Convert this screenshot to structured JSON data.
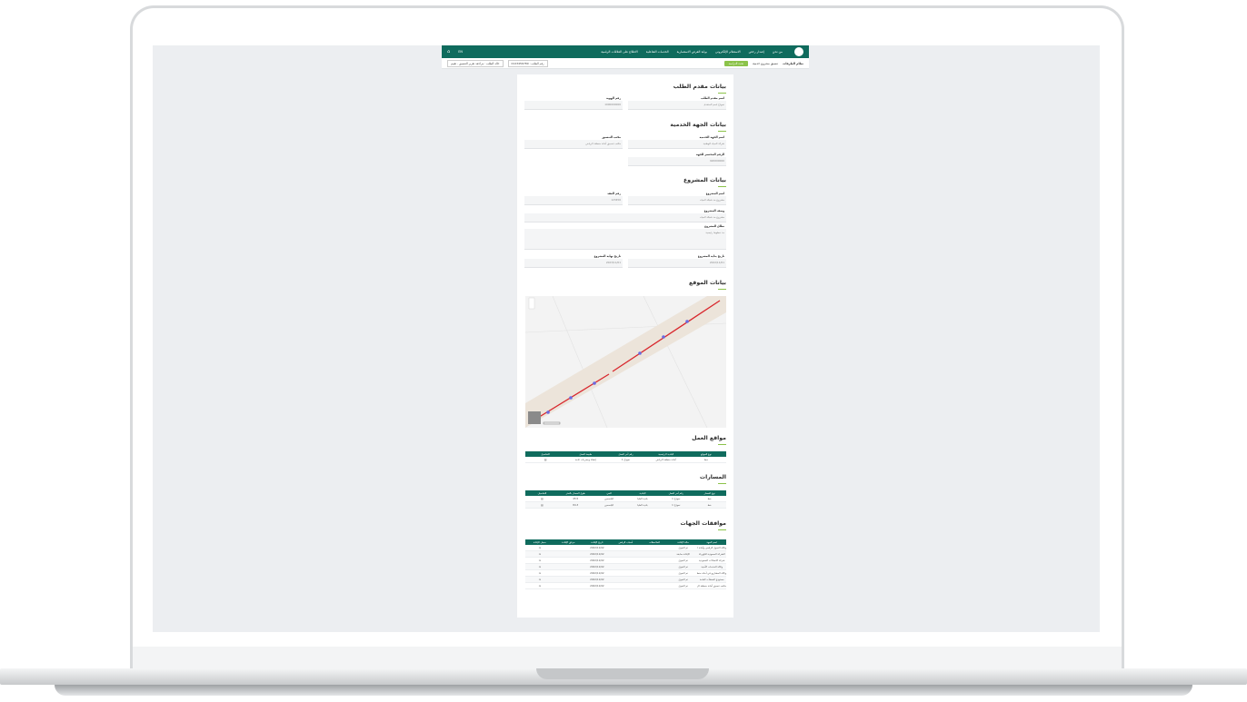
{
  "topbar": {
    "nav": [
      "من نحن",
      "إصدار رخص",
      "الاستعلام الإلكتروني",
      "بوابة الفرص الاستثمارية",
      "الخدمات التفاعلية",
      "الاطلاع على العلاقات الرقمية"
    ],
    "lang": "EN"
  },
  "subbar": {
    "system": "نظام الطرقات",
    "service": "تنسيق مشروع خدمية",
    "status": "تحت الدراسة",
    "request_type": "حالة الطلب : مراجعة تقرير التنسيق - تقييم",
    "request_no": "رقم الطلب : 0123456789"
  },
  "sections": {
    "applicant": "بيانات مقدم الطلب",
    "entity": "بيانات الجهة الخدمية",
    "project": "بيانات المشروع",
    "location": "بيانات الموقع",
    "work_sites": "مواقع العمل",
    "paths": "المسارات",
    "approvals": "موافقات الجهات"
  },
  "applicant": {
    "name_label": "اسم مقدم الطلب",
    "name_value": "نموذج اسم المتقدم",
    "id_label": "رقم الهوية",
    "id_value": "1000000000"
  },
  "entity": {
    "name_label": "اسم الجهة الخدمية",
    "name_value": "شركة المياه الوطنية",
    "office_label": "مكتب التنسيق",
    "office_value": "مكتب تنسيق أمانة منطقة الرياض",
    "phone_label": "الرقم المختصر للجهة",
    "phone_value": "920000000"
  },
  "project": {
    "name_label": "اسم المشروع",
    "name_value": "مشروع مد شبكة المياه",
    "contract_label": "رقم العقد",
    "contract_value": "123456",
    "desc_label": "وصف المشروع",
    "desc_value": "مشروع مد شبكة المياه",
    "scope_label": "نطاق المشروع",
    "scope_value": "مد خطوط رئيسية",
    "start_label": "تاريخ بداية المشروع",
    "start_value": "2022/11/01",
    "end_label": "تاريخ نهاية المشروع",
    "end_value": "2023/11/01"
  },
  "work_sites": {
    "headers": [
      "نوع الموقع",
      "البلدية الرئيسية",
      "رقم أمر العمل",
      "طبيعة العمل",
      "التفاصيل"
    ],
    "rows": [
      [
        "خط",
        "أمانة منطقة الرياض",
        "نموذج 1",
        "إنشاء وحفريات عامة",
        "▤"
      ]
    ]
  },
  "paths": {
    "headers": [
      "نوع المسار",
      "رقم أمر العمل",
      "البلدية",
      "الحي",
      "طول المسار بالمتر",
      "التفاصيل"
    ],
    "rows": [
      [
        "خط",
        "نموذج 1",
        "بلدية العليا",
        "الياسمين",
        "45.5",
        "▤"
      ],
      [
        "خط",
        "نموذج 1",
        "بلدية العليا",
        "الياسمين",
        "84.3",
        "▤"
      ]
    ]
  },
  "approvals": {
    "headers": [
      "اسم الجهة",
      "حالة الإفادة",
      "الملاحظات",
      "أسباب الرفض",
      "تاريخ الإفادة",
      "مرفق الإفادة",
      "سجل الإفادة"
    ],
    "rows": [
      [
        "وكالة التحول الرقمي وأمانة المنطقة",
        "تم القبول",
        "",
        "",
        "2022/11/02",
        "",
        "⇲"
      ],
      [
        "الشركة السعودية للكهرباء",
        "الإفادة سابقة",
        "",
        "",
        "2022/11/02",
        "",
        "⇲"
      ],
      [
        "شركة الاتصالات السعودية",
        "تم القبول",
        "",
        "",
        "2022/11/02",
        "",
        "⇲"
      ],
      [
        "وكالة الخدمات الأمنية",
        "تم القبول",
        "",
        "",
        "2022/11/02",
        "",
        "⇲"
      ],
      [
        "وكالة المشاريع في أمانة منطقة",
        "تم القبول",
        "",
        "",
        "2022/11/02",
        "",
        "⇲"
      ],
      [
        "مستودع المنشآت العامة",
        "تم القبول",
        "",
        "",
        "2022/11/02",
        "",
        "⇲"
      ],
      [
        "مكتب تنسيق أمانة منطقة الرياض",
        "تم القبول",
        "",
        "",
        "2022/11/02",
        "",
        "⇲"
      ]
    ]
  }
}
